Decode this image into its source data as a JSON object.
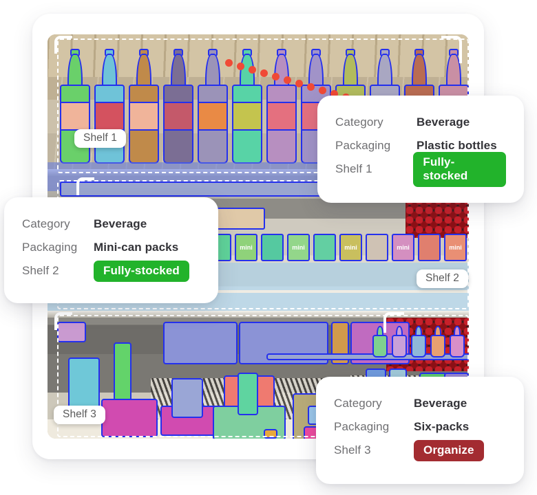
{
  "scene": {
    "description": "Retail shelf photo with AI instance-segmentation overlay",
    "shelf_labels": [
      {
        "id": "shelf-1",
        "text": "Shelf 1"
      },
      {
        "id": "shelf-2",
        "text": "Shelf 2"
      },
      {
        "id": "shelf-3",
        "text": "Shelf 3"
      }
    ]
  },
  "colors": {
    "segmentation_outline": "#2430ee",
    "badge_stocked": "#22b32b",
    "badge_organize": "#a32c31",
    "card_background": "#ffffff",
    "page_background": "#ffffff",
    "key_text": "#6f6f72",
    "value_text": "#333338"
  },
  "cards": [
    {
      "id": "card-shelf-1",
      "rows": [
        {
          "key": "Category",
          "value": "Beverage"
        },
        {
          "key": "Packaging",
          "value": "Plastic bottles"
        }
      ],
      "status": {
        "key": "Shelf 1",
        "label": "Fully-stocked",
        "variant": "green"
      }
    },
    {
      "id": "card-shelf-2",
      "rows": [
        {
          "key": "Category",
          "value": "Beverage"
        },
        {
          "key": "Packaging",
          "value": "Mini-can packs"
        }
      ],
      "status": {
        "key": "Shelf 2",
        "label": "Fully-stocked",
        "variant": "green"
      }
    },
    {
      "id": "card-shelf-3",
      "rows": [
        {
          "key": "Category",
          "value": "Beverage"
        },
        {
          "key": "Packaging",
          "value": "Six-packs"
        }
      ],
      "status": {
        "key": "Shelf 3",
        "label": "Organize",
        "variant": "red"
      }
    }
  ],
  "can_text": "mini"
}
